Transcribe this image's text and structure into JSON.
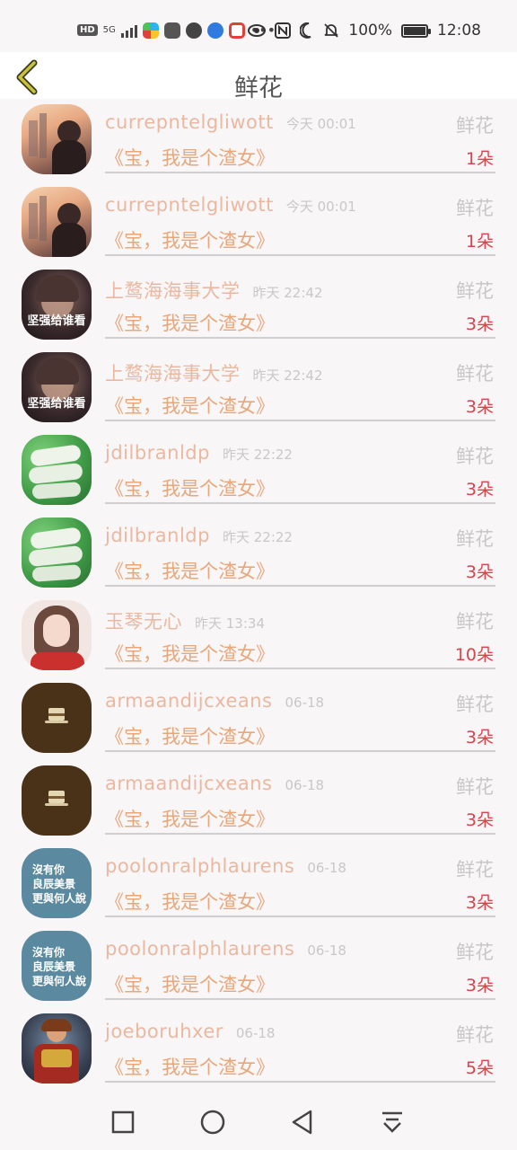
{
  "status_bar": {
    "network_badge": "HD",
    "network_type": "5G",
    "battery": "100%",
    "time": "12:08",
    "app_colors": [
      "#2db4ee",
      "#555555",
      "#444444",
      "#2f7be0",
      "#e0403a"
    ],
    "icons": [
      "eye-icon",
      "nfc-icon",
      "moon-icon",
      "bell-off-icon",
      "battery-icon"
    ]
  },
  "header": {
    "title": "鲜花",
    "back_icon": "chevron-left-icon",
    "accent_color": "#a39a2a"
  },
  "colors": {
    "username": "#eab8a1",
    "message": "#e8a77b",
    "count": "#d9434c",
    "meta": "#c8c8c8"
  },
  "items": [
    {
      "username": "currepntelgliwott",
      "time": "今天 00:01",
      "gift": "鲜花",
      "message": "《宝，我是个渣女》",
      "count": "1朵",
      "avatar": "sunset-woman"
    },
    {
      "username": "currepntelgliwott",
      "time": "今天 00:01",
      "gift": "鲜花",
      "message": "《宝，我是个渣女》",
      "count": "1朵",
      "avatar": "sunset-woman"
    },
    {
      "username": "上鹜海海事大学",
      "time": "昨天 22:42",
      "gift": "鲜花",
      "message": "《宝，我是个渣女》",
      "count": "3朵",
      "avatar": "dark-portrait",
      "avatar_caption": "坚强给谁看"
    },
    {
      "username": "上鹜海海事大学",
      "time": "昨天 22:42",
      "gift": "鲜花",
      "message": "《宝，我是个渣女》",
      "count": "3朵",
      "avatar": "dark-portrait",
      "avatar_caption": "坚强给谁看"
    },
    {
      "username": "jdilbranldp",
      "time": "昨天 22:22",
      "gift": "鲜花",
      "message": "《宝，我是个渣女》",
      "count": "3朵",
      "avatar": "jade-rabbits"
    },
    {
      "username": "jdilbranldp",
      "time": "昨天 22:22",
      "gift": "鲜花",
      "message": "《宝，我是个渣女》",
      "count": "3朵",
      "avatar": "jade-rabbits"
    },
    {
      "username": "玉琴无心",
      "time": "昨天 13:34",
      "gift": "鲜花",
      "message": "《宝，我是个渣女》",
      "count": "10朵",
      "avatar": "anime-girl"
    },
    {
      "username": "armaandijcxeans",
      "time": "06-18",
      "gift": "鲜花",
      "message": "《宝，我是个渣女》",
      "count": "3朵",
      "avatar": "brown-cake"
    },
    {
      "username": "armaandijcxeans",
      "time": "06-18",
      "gift": "鲜花",
      "message": "《宝，我是个渣女》",
      "count": "3朵",
      "avatar": "brown-cake"
    },
    {
      "username": "poolonralphlaurens",
      "time": "06-18",
      "gift": "鲜花",
      "message": "《宝，我是个渣女》",
      "count": "3朵",
      "avatar": "blue-text",
      "avatar_caption_lines": [
        "沒有你",
        "良辰美景",
        "更與何人說"
      ]
    },
    {
      "username": "poolonralphlaurens",
      "time": "06-18",
      "gift": "鲜花",
      "message": "《宝，我是个渣女》",
      "count": "3朵",
      "avatar": "blue-text",
      "avatar_caption_lines": [
        "沒有你",
        "良辰美景",
        "更與何人說"
      ]
    },
    {
      "username": "joeboruhxer",
      "time": "06-18",
      "gift": "鲜花",
      "message": "《宝，我是个渣女》",
      "count": "5朵",
      "avatar": "warrior"
    }
  ],
  "nav_bar": {
    "buttons": [
      "recent-apps-icon",
      "home-icon",
      "back-icon",
      "pull-down-icon"
    ]
  }
}
